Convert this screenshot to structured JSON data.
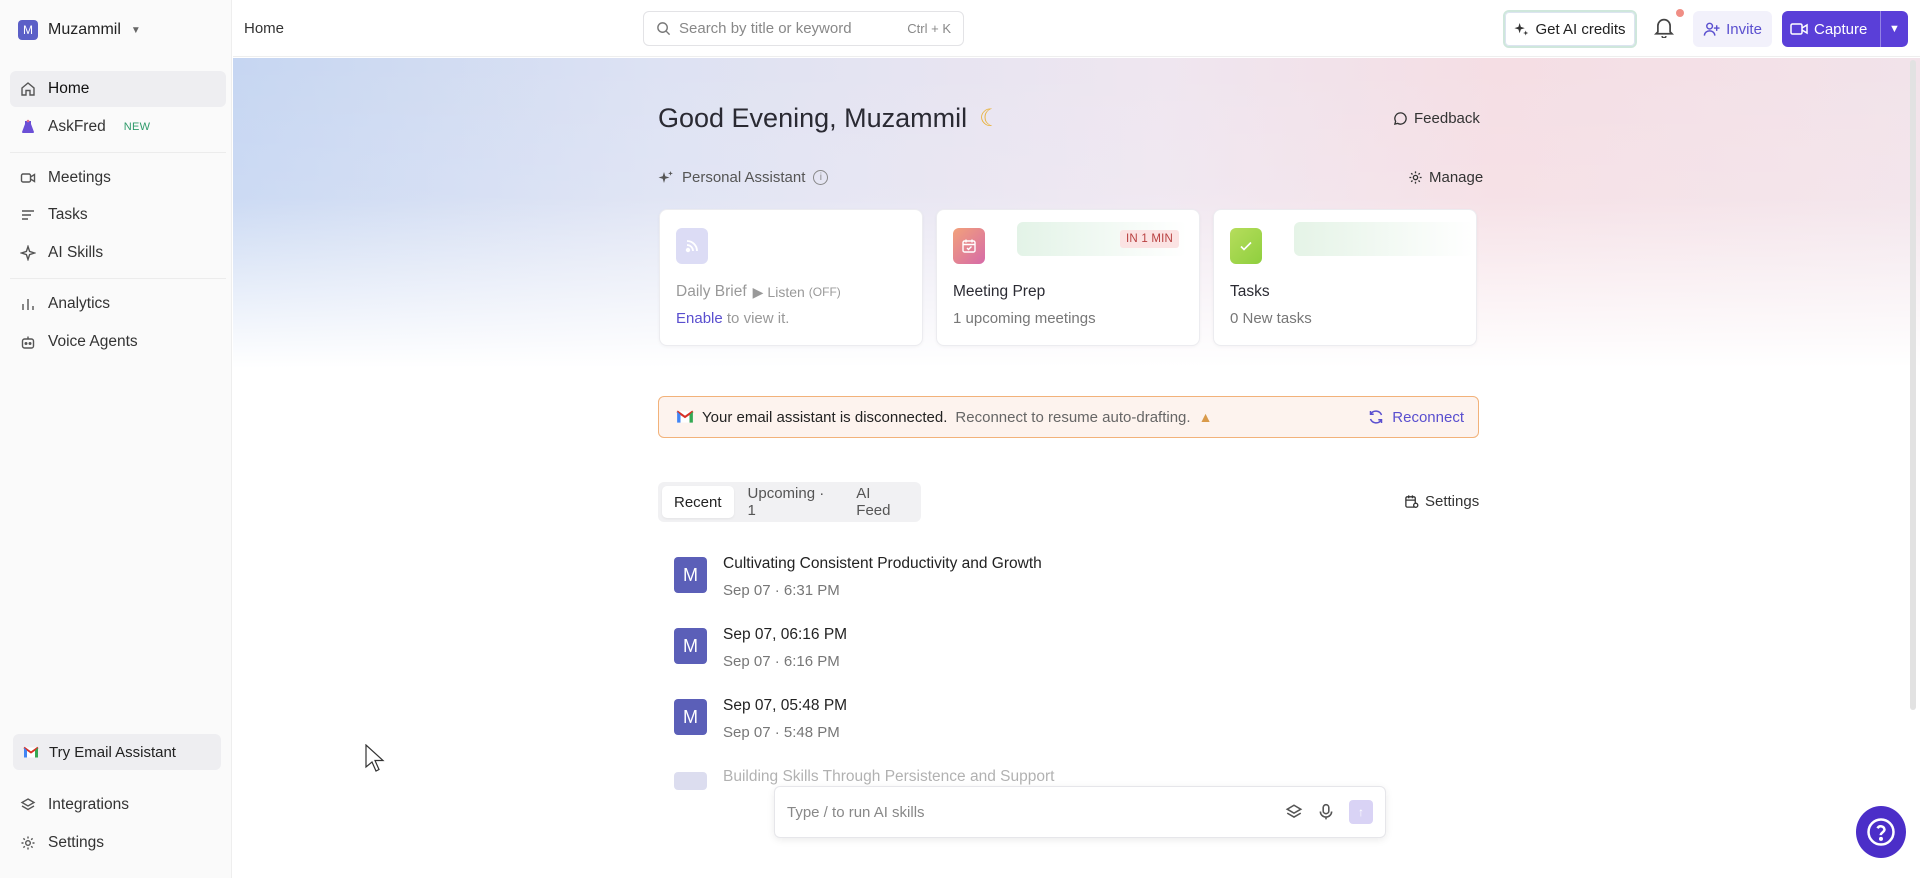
{
  "workspace": {
    "initial": "M",
    "name": "Muzammil"
  },
  "sidebar": {
    "items": [
      {
        "label": "Home",
        "icon": "home-icon"
      },
      {
        "label": "AskFred",
        "badge": "NEW",
        "icon": "askfred-icon"
      },
      {
        "label": "Meetings",
        "icon": "video-icon"
      },
      {
        "label": "Tasks",
        "icon": "tasks-icon"
      },
      {
        "label": "AI Skills",
        "icon": "sparkle-icon"
      },
      {
        "label": "Analytics",
        "icon": "bar-chart-icon"
      },
      {
        "label": "Voice Agents",
        "icon": "robot-icon"
      }
    ],
    "try_email": "Try Email Assistant",
    "bottom": [
      {
        "label": "Integrations",
        "icon": "layers-icon"
      },
      {
        "label": "Settings",
        "icon": "gear-icon"
      }
    ]
  },
  "topbar": {
    "breadcrumb": "Home",
    "search_placeholder": "Search by title or keyword",
    "search_shortcut": "Ctrl + K",
    "ai_credits": "Get AI credits",
    "invite": "Invite",
    "capture": "Capture"
  },
  "main": {
    "greeting": "Good Evening, Muzammil",
    "feedback": "Feedback",
    "personal_assistant": "Personal Assistant",
    "manage": "Manage",
    "cards": {
      "daily_brief": {
        "title": "Daily Brief",
        "listen": "Listen",
        "listen_state": "(OFF)",
        "enable": "Enable",
        "sub": " to view it."
      },
      "meeting_prep": {
        "title": "Meeting Prep",
        "badge": "IN 1 MIN",
        "sub": "1 upcoming meetings"
      },
      "tasks": {
        "title": "Tasks",
        "sub": "0 New tasks"
      }
    },
    "alert": {
      "strong": "Your email assistant is disconnected.",
      "text": "Reconnect to resume auto-drafting.",
      "action": "Reconnect"
    },
    "tabs": [
      {
        "label": "Recent"
      },
      {
        "label": "Upcoming · 1"
      },
      {
        "label": "AI Feed"
      }
    ],
    "list_settings": "Settings",
    "meetings": [
      {
        "initial": "M",
        "title": "Cultivating Consistent Productivity and Growth",
        "date": "Sep 07",
        "time": "6:31 PM"
      },
      {
        "initial": "M",
        "title": "Sep 07, 06:16 PM",
        "date": "Sep 07",
        "time": "6:16 PM"
      },
      {
        "initial": "M",
        "title": "Sep 07, 05:48 PM",
        "date": "Sep 07",
        "time": "5:48 PM"
      },
      {
        "initial": "M",
        "title": "Building Skills Through Persistence and Support"
      }
    ],
    "assistant_placeholder": "Type / to run AI skills"
  },
  "colors": {
    "accent": "#5a3fd8",
    "alert_border": "#f2b27a",
    "avatar": "#5b5fb8"
  }
}
